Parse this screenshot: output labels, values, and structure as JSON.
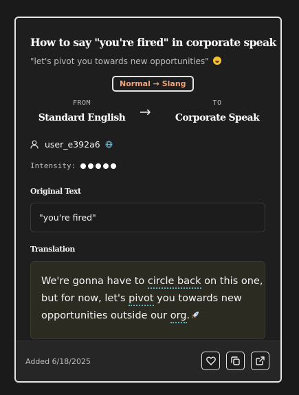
{
  "card": {
    "title": "How to say \"you're fired\" in corporate speak",
    "subtitle": "\"let's pivot you towards new opportunities\"",
    "subtitle_emoji": "laughing-emoji",
    "badge": "Normal → Slang",
    "from_label": "FROM",
    "from_lang": "Standard English",
    "arrow": "→",
    "to_label": "TO",
    "to_lang": "Corporate Speak",
    "user": {
      "name": "user_e392a6",
      "icon": "user-icon",
      "badge_icon": "globe-icon"
    },
    "intensity": {
      "label": "Intensity:",
      "level": 5,
      "max": 5
    },
    "original_label": "Original Text",
    "original_text": "\"you're fired\"",
    "translation_label": "Translation",
    "translation": {
      "line1_pre": "We're gonna have to ",
      "line1_term": "circle back",
      "line1_post": " on this one,",
      "line2_pre": "but for now, let's ",
      "line2_term": "pivot",
      "line2_post": " you towards new",
      "line3_pre": "opportunities outside our ",
      "line3_term": "org",
      "line3_post": ".",
      "emoji": "rocket-emoji"
    },
    "footer": {
      "added": "Added 6/18/2025",
      "buttons": [
        "heart-icon",
        "copy-icon",
        "external-link-icon"
      ]
    }
  },
  "colors": {
    "page_bg": "#1a1a1a",
    "card_bg": "#1e1e1e",
    "card_border": "#e6e6e6",
    "badge_text": "#f0a27a",
    "translation_bg": "#2b2b22",
    "term_underline": "#5fb3c7",
    "footer_bg": "#262626"
  }
}
